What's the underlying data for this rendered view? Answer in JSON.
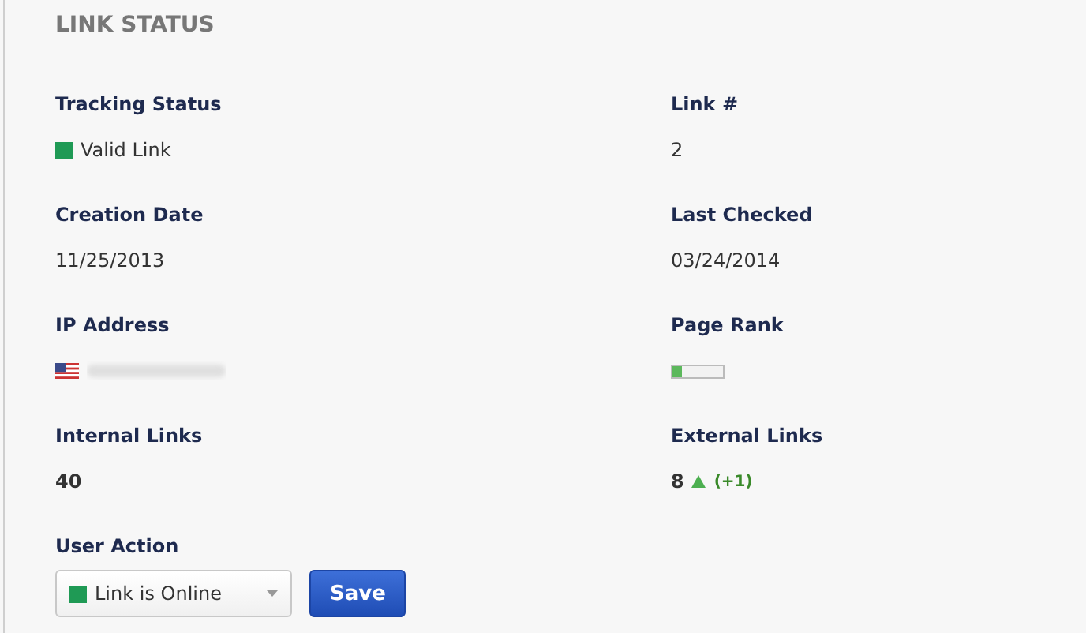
{
  "title": "LINK STATUS",
  "fields": [
    {
      "kind": "status",
      "label": "Tracking Status",
      "value": "Valid Link",
      "color": "#1f9a55"
    },
    {
      "kind": "text",
      "label": "Link #",
      "value": "2"
    },
    {
      "kind": "text",
      "label": "Creation Date",
      "value": "11/25/2013"
    },
    {
      "kind": "text",
      "label": "Last Checked",
      "value": "03/24/2014"
    },
    {
      "kind": "ip",
      "label": "IP Address"
    },
    {
      "kind": "rank",
      "label": "Page Rank",
      "level": 0.2
    },
    {
      "kind": "count",
      "label": "Internal Links",
      "value": "40"
    },
    {
      "kind": "count",
      "label": "External Links",
      "value": "8",
      "change": "(+1)"
    }
  ],
  "user_action": {
    "label": "User Action",
    "select": {
      "value": "Link is Online",
      "color": "#1f9a55"
    },
    "button": "Save"
  }
}
